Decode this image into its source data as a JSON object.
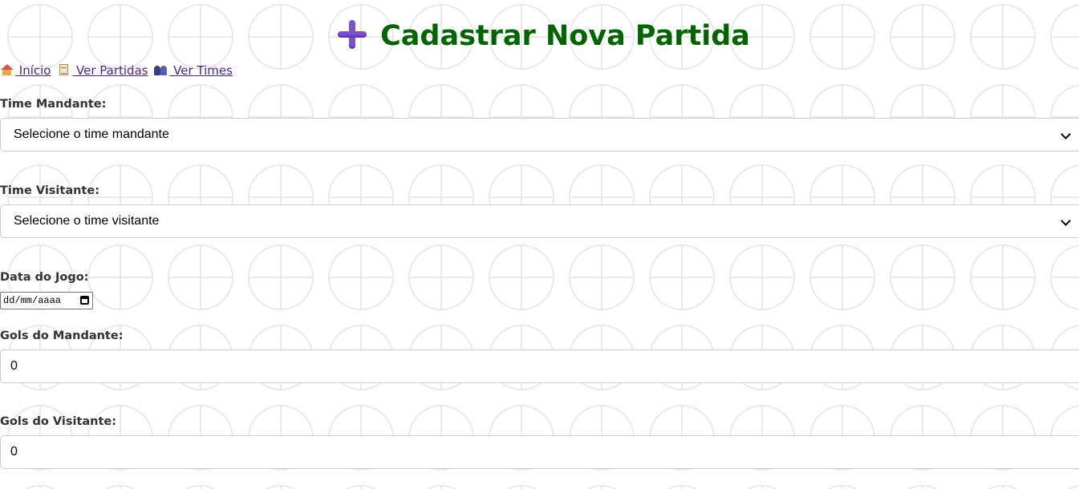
{
  "page": {
    "title": "Cadastrar Nova Partida",
    "icon": "plus-icon",
    "title_color": "#006400"
  },
  "nav": {
    "links": [
      {
        "label": " Início",
        "icon": "house-icon"
      },
      {
        "label": " Ver Partidas",
        "icon": "clipboard-icon"
      },
      {
        "label": " Ver Times",
        "icon": "people-icon"
      }
    ],
    "link_color": "#551a8b"
  },
  "form": {
    "home_team": {
      "label": "Time Mandante:",
      "value": "Selecione o time mandante"
    },
    "away_team": {
      "label": "Time Visitante:",
      "value": "Selecione o time visitante"
    },
    "match_date": {
      "label": "Data do Jogo:",
      "placeholder": "dd/mm/aaaa"
    },
    "home_goals": {
      "label": "Gols do Mandante:",
      "value": "0"
    },
    "away_goals": {
      "label": "Gols do Visitante:",
      "value": "0"
    }
  }
}
